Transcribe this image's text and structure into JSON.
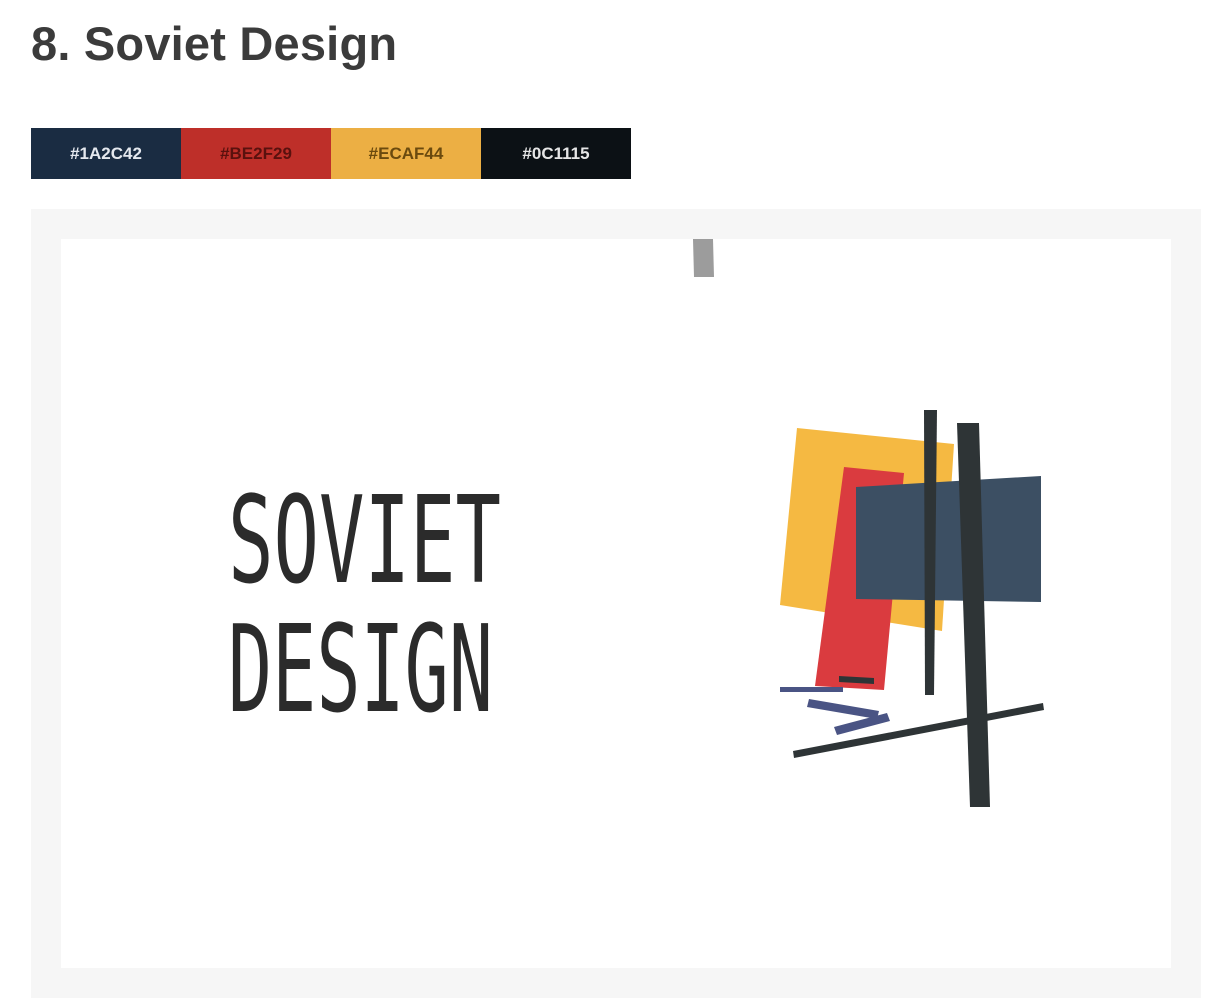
{
  "section": {
    "title": "8. Soviet Design"
  },
  "palette": [
    {
      "hex": "#1A2C42",
      "label": "#1A2C42",
      "text_color": "#e4e8ee"
    },
    {
      "hex": "#BE2F29",
      "label": "#BE2F29",
      "text_color": "#5a110e"
    },
    {
      "hex": "#ECAF44",
      "label": "#ECAF44",
      "text_color": "#6b4a0e"
    },
    {
      "hex": "#0C1115",
      "label": "#0C1115",
      "text_color": "#e6e6e6"
    }
  ],
  "artwork": {
    "line1": "SOVIET",
    "line2": "DESIGN",
    "colors": {
      "text": "#2b2b2b",
      "yellow": "#F5B942",
      "red": "#DA3B3F",
      "navy": "#3C4F63",
      "bars": "#2E3436",
      "violet": "#4A5484",
      "grey": "#9c9c9c"
    }
  }
}
